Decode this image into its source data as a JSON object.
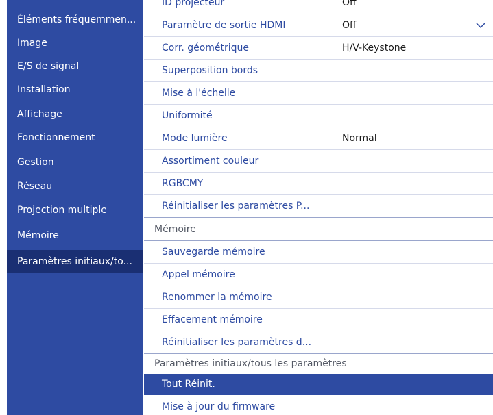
{
  "sidebar": {
    "items": [
      {
        "label": "Éléments fréquemmen..."
      },
      {
        "label": "Image"
      },
      {
        "label": "E/S de signal"
      },
      {
        "label": "Installation"
      },
      {
        "label": "Affichage"
      },
      {
        "label": "Fonctionnement"
      },
      {
        "label": "Gestion"
      },
      {
        "label": "Réseau"
      },
      {
        "label": "Projection multiple"
      },
      {
        "label": "Mémoire"
      },
      {
        "label": "Paramètres initiaux/to..."
      }
    ]
  },
  "content": {
    "partial_top": {
      "label": "ID projecteur",
      "value": "Off"
    },
    "items": [
      {
        "label": "Paramètre de sortie HDMI",
        "value": "Off"
      },
      {
        "label": "Corr. géométrique",
        "value": "H/V-Keystone"
      },
      {
        "label": "Superposition bords"
      },
      {
        "label": "Mise à l'échelle"
      },
      {
        "label": "Uniformité"
      },
      {
        "label": "Mode lumière",
        "value": "Normal"
      },
      {
        "label": "Assortiment couleur"
      },
      {
        "label": "RGBCMY"
      },
      {
        "label": "Réinitialiser les paramètres P..."
      }
    ],
    "memory_section": {
      "title": "Mémoire",
      "items": [
        {
          "label": "Sauvegarde mémoire"
        },
        {
          "label": "Appel mémoire"
        },
        {
          "label": "Renommer la mémoire"
        },
        {
          "label": "Effacement mémoire"
        },
        {
          "label": "Réinitialiser les paramètres d..."
        }
      ]
    },
    "reset_section": {
      "title": "Paramètres initiaux/tous les paramètres",
      "items": [
        {
          "label": "Tout Réinit."
        },
        {
          "label": "Mise à jour du firmware"
        }
      ]
    }
  },
  "icons": {
    "dropdown": "chevron-down-icon"
  },
  "colors": {
    "sidebar_bg": "#2e4ba2",
    "sidebar_active_bg": "#1a2f73",
    "item_text": "#2e4ba2",
    "selected_bg": "#2e4ba2",
    "section_text": "#555a66"
  }
}
